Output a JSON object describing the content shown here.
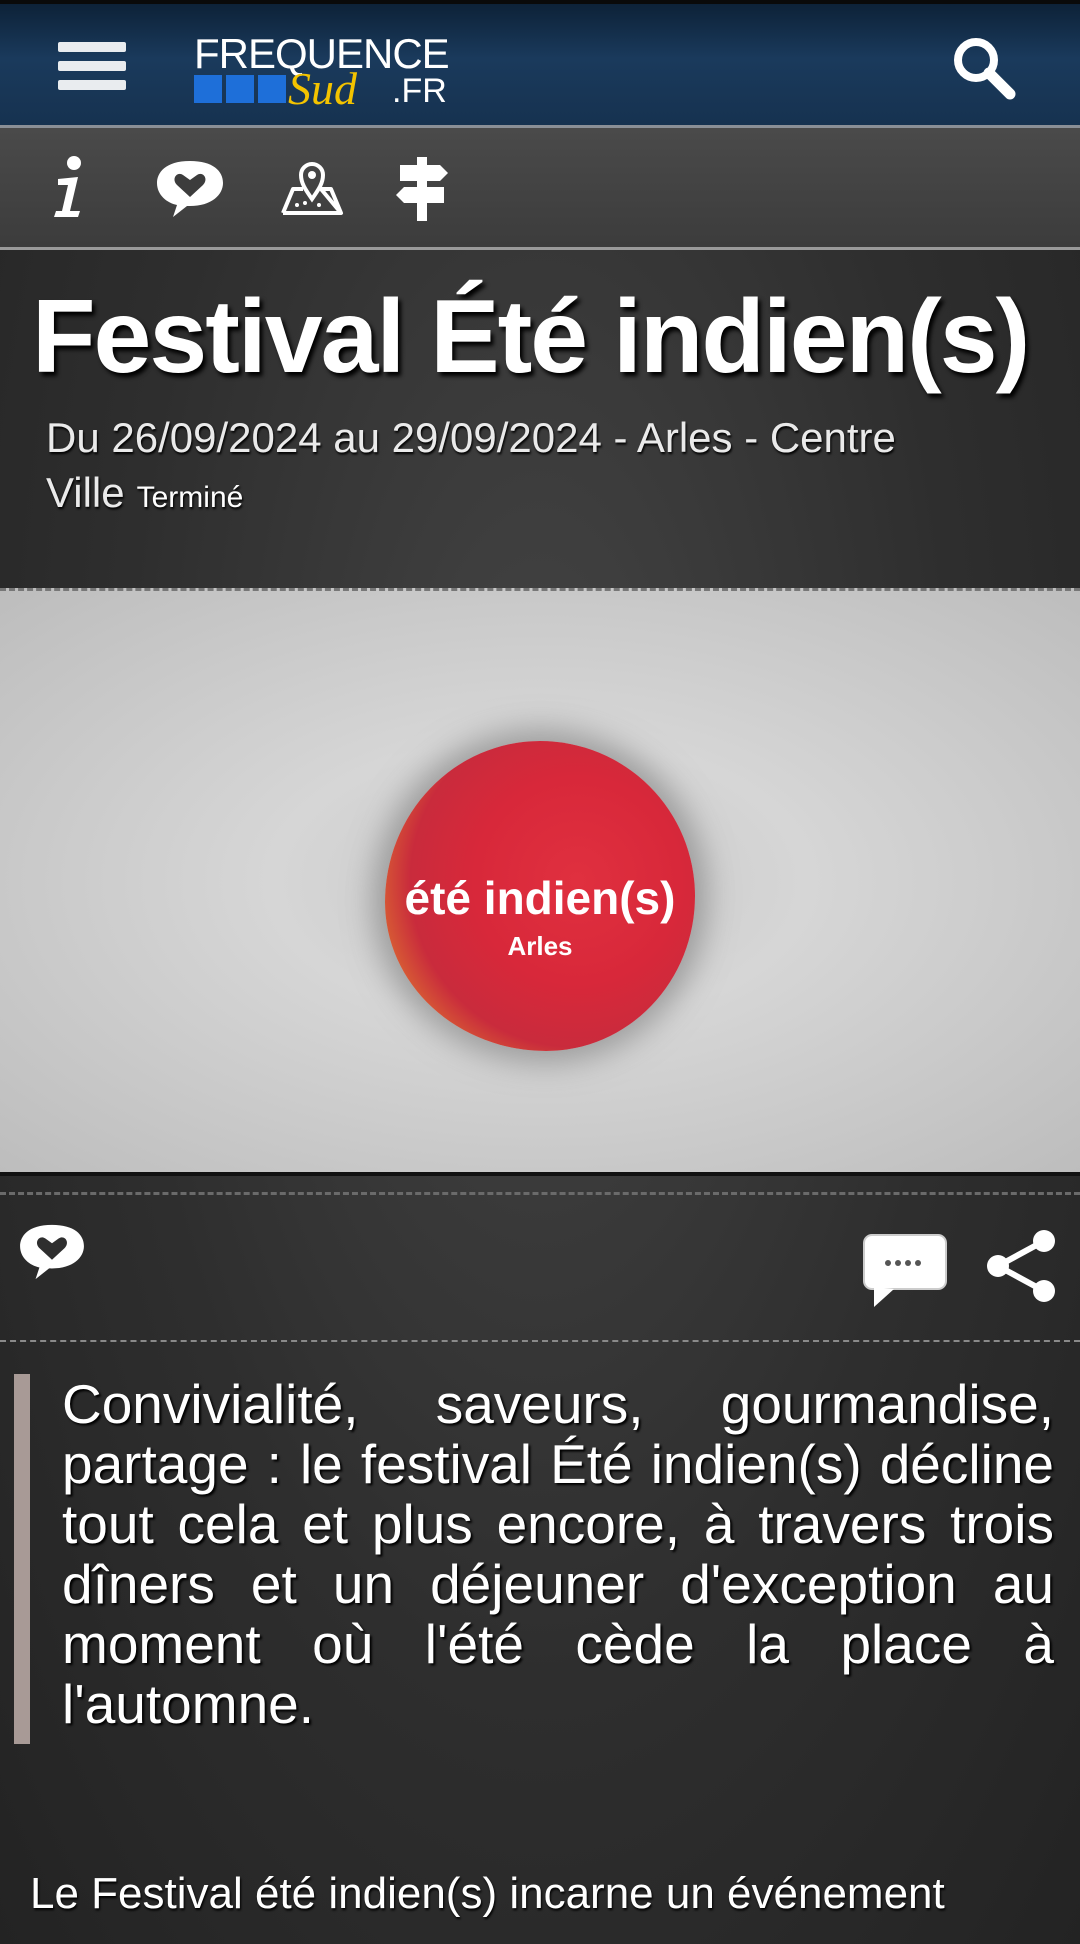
{
  "header": {
    "logo_text_top": "FREQUENCE",
    "logo_text_script": "Sud",
    "logo_text_suffix": ".FR"
  },
  "icons": {
    "menu": "hamburger-menu-icon",
    "search": "search-icon",
    "info": "info-icon",
    "favorite": "heart-speech-icon",
    "map": "map-pin-icon",
    "directions": "signpost-icon",
    "comment": "comment-icon",
    "share": "share-icon"
  },
  "event": {
    "title": "Festival Été indien(s)",
    "dates_location": "Du 26/09/2024 au 29/09/2024 - Arles - Centre Ville",
    "status": "Terminé"
  },
  "hero": {
    "logo_line1": "été indien(s)",
    "logo_line2": "Arles"
  },
  "intro": "Convivialité, saveurs, gourmandise, partage : le festival Été indien(s) décline tout cela et plus encore, à travers trois dîners et un déjeuner d'exception au moment où l'été cède la place à l'automne.",
  "body": "Le Festival été indien(s) incarne un événement",
  "colors": {
    "header_bg": "#163250",
    "accent_blue": "#1e6fd9",
    "accent_yellow": "#f3c300",
    "quote_bar": "#a89a96"
  }
}
